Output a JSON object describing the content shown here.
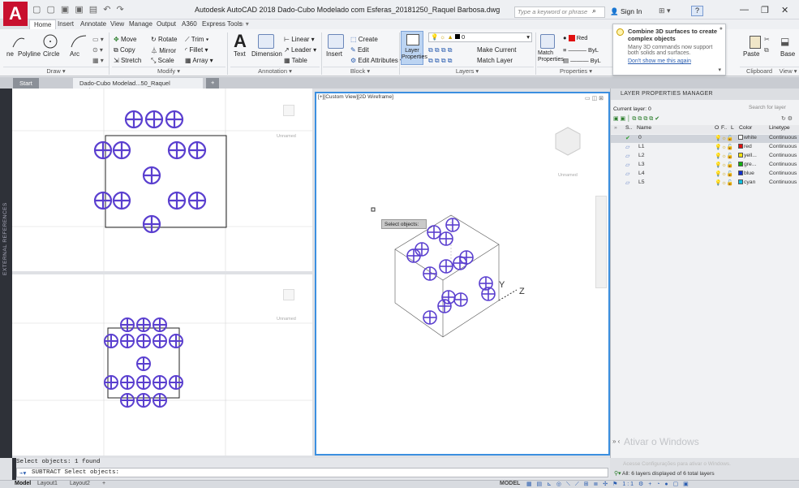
{
  "titlebar": {
    "app_letter": "A",
    "qat_icons": "▢ ▢ ▣ ▣ ▤ ↶ ↷",
    "title": "Autodesk AutoCAD 2018   Dado-Cubo Modelado com Esferas_20181250_Raquel Barbosa.dwg",
    "search_placeholder": "Type a keyword or phrase",
    "signin": "Sign In",
    "help_icon": "?",
    "minimize": "—",
    "restore": "❐",
    "close": "✕"
  },
  "ribbon_tabs": [
    "Home",
    "Insert",
    "Annotate",
    "View",
    "Manage",
    "Output",
    "A360",
    "Express Tools"
  ],
  "ribbon": {
    "draw": {
      "tools": [
        "ne",
        "Polyline",
        "Circle",
        "Arc"
      ],
      "label": "Draw ▾"
    },
    "modify": {
      "rows": [
        [
          "Move",
          "Rotate",
          "Trim ▾"
        ],
        [
          "Copy",
          "Mirror",
          "Fillet ▾"
        ],
        [
          "Stretch",
          "Scale",
          "Array ▾"
        ]
      ],
      "label": "Modify ▾"
    },
    "annotation": {
      "tools": [
        "Text",
        "Dimension"
      ],
      "items": [
        "Linear ▾",
        "Leader ▾",
        "Table"
      ],
      "label": "Annotation ▾"
    },
    "block": {
      "tools": [
        "Insert"
      ],
      "items": [
        "Create",
        "Edit",
        "Edit Attributes ▾"
      ],
      "label": "Block ▾"
    },
    "layers": {
      "tool": "Layer Properties",
      "current": "0",
      "items": [
        "Make Current",
        "Match Layer"
      ],
      "label": "Layers ▾"
    },
    "properties": {
      "tool": "Match Properties",
      "color": "Red",
      "lines": [
        "ByL",
        "ByL"
      ],
      "label": "Properties ▾"
    },
    "clipboard": {
      "tool": "Paste",
      "label": "Clipboard"
    },
    "view": {
      "tool": "Base",
      "label": "View ▾"
    }
  },
  "tooltip": {
    "title": "Combine 3D surfaces to create complex objects",
    "body": "Many 3D commands now support both solids and surfaces.",
    "link": "Don't show me this again"
  },
  "doc_tabs": {
    "start": "Start",
    "active": "Dado-Cubo Modelad...50_Raquel Barbosa*",
    "close": "✕",
    "add": "+"
  },
  "left_strip": "EXTERNAL REFERENCES",
  "viewports": {
    "main_label": "[+][Custom View][2D Wireframe]",
    "unnamed": "Unnamed",
    "tooltip": "Select objects:",
    "axis_y": "Y",
    "axis_z": "Z"
  },
  "layer_manager": {
    "title": "LAYER PROPERTIES MANAGER",
    "current": "Current layer: 0",
    "search": "Search for layer",
    "columns": [
      "S..",
      "Name",
      "O",
      "F..",
      "L",
      "Color",
      "Linetype"
    ],
    "layers": [
      {
        "name": "0",
        "color_name": "white",
        "hex": "#ffffff",
        "linetype": "Continuous"
      },
      {
        "name": "L1",
        "color_name": "red",
        "hex": "#e01010",
        "linetype": "Continuous"
      },
      {
        "name": "L2",
        "color_name": "yell...",
        "hex": "#f0e010",
        "linetype": "Continuous"
      },
      {
        "name": "L3",
        "color_name": "gre...",
        "hex": "#10b010",
        "linetype": "Continuous"
      },
      {
        "name": "L4",
        "color_name": "blue",
        "hex": "#1030d0",
        "linetype": "Continuous"
      },
      {
        "name": "L5",
        "color_name": "cyan",
        "hex": "#10c0e0",
        "linetype": "Continuous"
      }
    ],
    "watermark_1": "Ativar o Windows",
    "watermark_2": "Acesse Configurações para ativar o Windows.",
    "footer": "All: 6 layers displayed of 6 total layers"
  },
  "command": {
    "history": "Select objects: 1 found",
    "line": "SUBTRACT Select objects:"
  },
  "status": {
    "tabs": [
      "Model",
      "Layout1",
      "Layout2",
      "+"
    ],
    "model_label": "MODEL"
  },
  "colors": {
    "accent": "#4a6fc0",
    "sphere": "#5a3fcf",
    "highlight": "#3b8fe0"
  }
}
